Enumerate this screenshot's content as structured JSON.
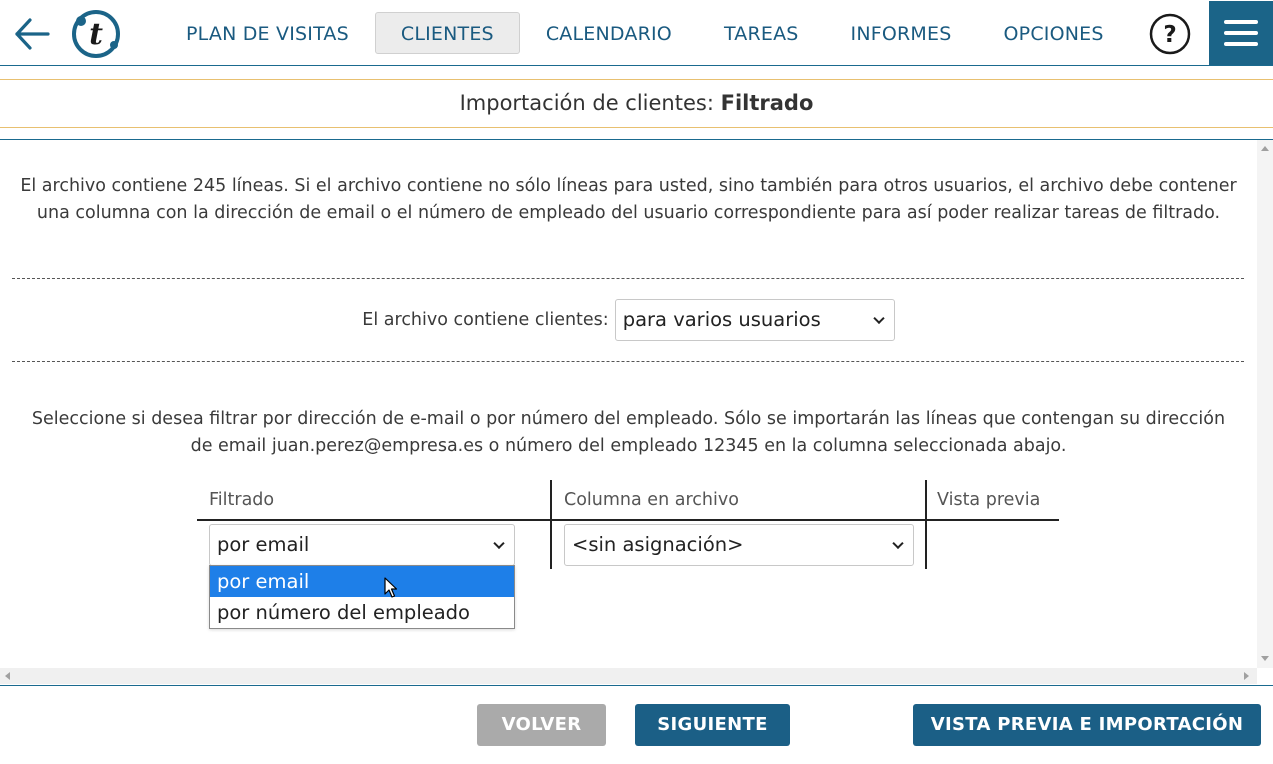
{
  "nav": {
    "items": [
      {
        "label": "PLAN DE VISITAS",
        "active": false
      },
      {
        "label": "CLIENTES",
        "active": true
      },
      {
        "label": "CALENDARIO",
        "active": false
      },
      {
        "label": "TAREAS",
        "active": false
      },
      {
        "label": "INFORMES",
        "active": false
      },
      {
        "label": "OPCIONES",
        "active": false
      }
    ],
    "help_label": "?",
    "logo_letter": "t"
  },
  "title": {
    "prefix": "Importación de clientes:",
    "bold": "Filtrado"
  },
  "intro_text": "El archivo contiene 245 líneas. Si el archivo contiene no sólo líneas para usted, sino también para otros usuarios, el archivo debe contener una columna con la dirección de email o el número de empleado del usuario correspondiente para así poder realizar tareas de filtrado.",
  "clients_row": {
    "label": "El archivo contiene clientes:",
    "selected": "para varios usuarios"
  },
  "filter_text": "Seleccione si desea filtrar por dirección de e-mail o por número del empleado. Sólo se importarán las líneas que contengan su dirección de email juan.perez@empresa.es o número del empleado 12345 en la columna seleccionada abajo.",
  "filter_table": {
    "headers": [
      "Filtrado",
      "Columna en archivo",
      "Vista previa"
    ],
    "filter_selected": "por email",
    "column_selected": "<sin asignación>"
  },
  "dropdown": {
    "options": [
      "por email",
      "por número del empleado"
    ],
    "highlighted_index": 0
  },
  "footer": {
    "back_label": "VOLVER",
    "next_label": "SIGUIENTE",
    "import_label": "VISTA PREVIA E IMPORTACIÓN"
  },
  "colors": {
    "brand": "#1b6488",
    "nav_text": "#1a5a80",
    "title_border": "#e8c070",
    "highlight": "#1e7fe8",
    "disabled_button": "#aaaaaa"
  },
  "icons": {
    "back": "arrow-left-icon",
    "logo": "logo-icon",
    "help": "question-circle-icon",
    "menu": "hamburger-menu-icon",
    "chevron": "chevron-down-icon",
    "cursor": "mouse-pointer-icon"
  }
}
